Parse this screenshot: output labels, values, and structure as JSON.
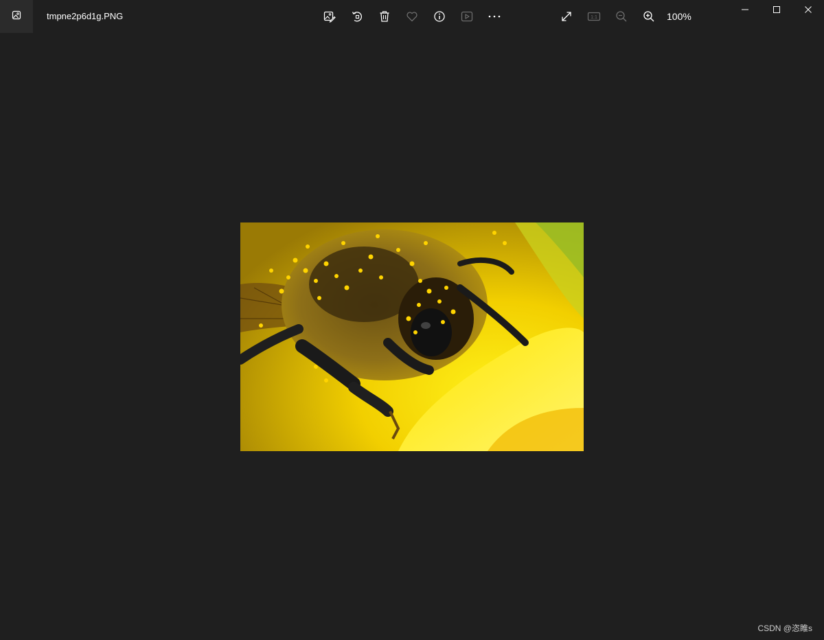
{
  "window": {
    "file_name": "tmpne2p6d1g.PNG",
    "zoom_level": "100%",
    "app_icon": "photos-app-icon"
  },
  "toolbar": {
    "items": [
      {
        "name": "edit-image-icon"
      },
      {
        "name": "rotate-icon"
      },
      {
        "name": "delete-icon"
      },
      {
        "name": "favorite-heart-icon",
        "disabled": true
      },
      {
        "name": "info-icon"
      },
      {
        "name": "slideshow-icon",
        "disabled": true
      },
      {
        "name": "more-options-icon"
      }
    ],
    "view_items": [
      {
        "name": "fullscreen-expand-icon"
      },
      {
        "name": "actual-size-icon",
        "label": "1:1",
        "disabled": true
      },
      {
        "name": "zoom-out-icon",
        "disabled": true
      },
      {
        "name": "zoom-in-icon"
      }
    ]
  },
  "window_controls": [
    {
      "name": "minimize-icon"
    },
    {
      "name": "maximize-icon"
    },
    {
      "name": "close-icon"
    }
  ],
  "image": {
    "subject": "bee-covered-in-pollen-on-yellow-flower"
  },
  "watermark": {
    "text": "CSDN @恣睢s"
  },
  "colors": {
    "background": "#1f1f1f",
    "icon": "#ffffff",
    "icon_disabled": "#6e6e6e",
    "app_icon_bg": "#2b2b2b"
  }
}
